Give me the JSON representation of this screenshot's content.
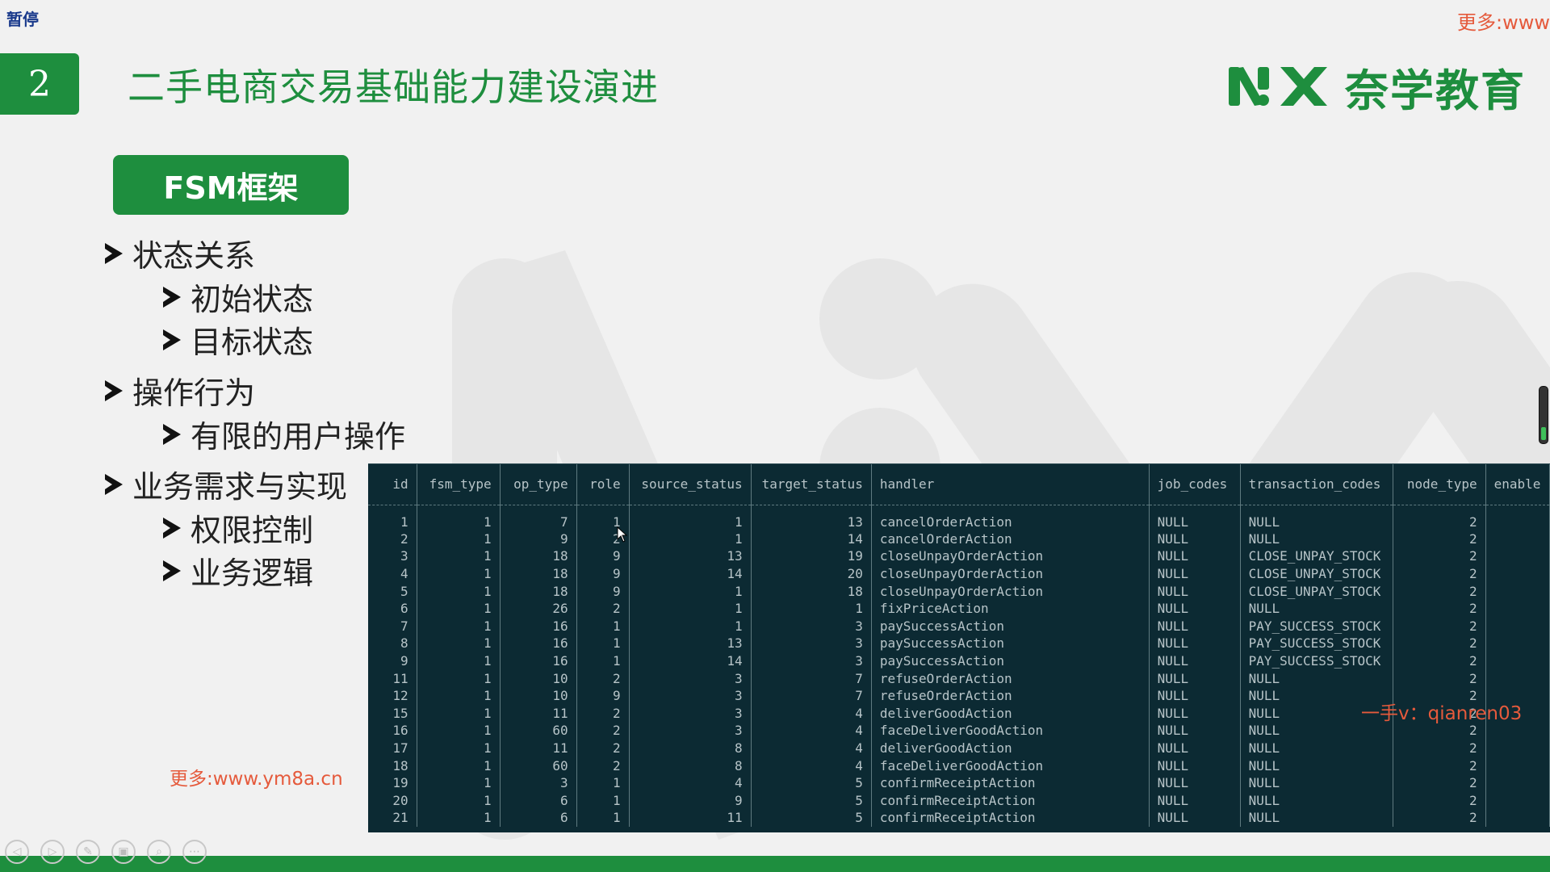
{
  "player": {
    "pause_label": "暂停",
    "controls": {
      "prev": "◁",
      "next": "▷",
      "pen": "✎",
      "slides": "▣",
      "zoom": "⌕",
      "more": "⋯"
    }
  },
  "watermarks": {
    "top_right": "更多:www",
    "left": "更多:www.ym8a.cn",
    "contact": "一手v：qianren03"
  },
  "slide": {
    "number": "2",
    "title": "二手电商交易基础能力建设演进",
    "logo_text": "奈学教育",
    "section_badge": "FSM框架",
    "bullets": [
      {
        "label": "状态关系",
        "sub": [
          "初始状态",
          "目标状态"
        ]
      },
      {
        "label": "操作行为",
        "sub": [
          "有限的用户操作"
        ]
      },
      {
        "label": "业务需求与实现",
        "sub": [
          "权限控制",
          "业务逻辑"
        ]
      }
    ]
  },
  "colors": {
    "brand_green": "#1e8e3e",
    "watermark_red": "#e55a3c",
    "terminal_bg": "#0c2a33",
    "terminal_text": "#b7c4c8"
  },
  "table": {
    "columns": [
      "id",
      "fsm_type",
      "op_type",
      "role",
      "source_status",
      "target_status",
      "handler",
      "job_codes",
      "transaction_codes",
      "node_type",
      "enable"
    ],
    "rows": [
      [
        "1",
        "1",
        "7",
        "1",
        "1",
        "13",
        "cancelOrderAction",
        "NULL",
        "NULL",
        "2"
      ],
      [
        "2",
        "1",
        "9",
        "2",
        "1",
        "14",
        "cancelOrderAction",
        "NULL",
        "NULL",
        "2"
      ],
      [
        "3",
        "1",
        "18",
        "9",
        "13",
        "19",
        "closeUnpayOrderAction",
        "NULL",
        "CLOSE_UNPAY_STOCK",
        "2"
      ],
      [
        "4",
        "1",
        "18",
        "9",
        "14",
        "20",
        "closeUnpayOrderAction",
        "NULL",
        "CLOSE_UNPAY_STOCK",
        "2"
      ],
      [
        "5",
        "1",
        "18",
        "9",
        "1",
        "18",
        "closeUnpayOrderAction",
        "NULL",
        "CLOSE_UNPAY_STOCK",
        "2"
      ],
      [
        "6",
        "1",
        "26",
        "2",
        "1",
        "1",
        "fixPriceAction",
        "NULL",
        "NULL",
        "2"
      ],
      [
        "7",
        "1",
        "16",
        "1",
        "1",
        "3",
        "paySuccessAction",
        "NULL",
        "PAY_SUCCESS_STOCK",
        "2"
      ],
      [
        "8",
        "1",
        "16",
        "1",
        "13",
        "3",
        "paySuccessAction",
        "NULL",
        "PAY_SUCCESS_STOCK",
        "2"
      ],
      [
        "9",
        "1",
        "16",
        "1",
        "14",
        "3",
        "paySuccessAction",
        "NULL",
        "PAY_SUCCESS_STOCK",
        "2"
      ],
      [
        "11",
        "1",
        "10",
        "2",
        "3",
        "7",
        "refuseOrderAction",
        "NULL",
        "NULL",
        "2"
      ],
      [
        "12",
        "1",
        "10",
        "9",
        "3",
        "7",
        "refuseOrderAction",
        "NULL",
        "NULL",
        "2"
      ],
      [
        "15",
        "1",
        "11",
        "2",
        "3",
        "4",
        "deliverGoodAction",
        "NULL",
        "NULL",
        "2"
      ],
      [
        "16",
        "1",
        "60",
        "2",
        "3",
        "4",
        "faceDeliverGoodAction",
        "NULL",
        "NULL",
        "2"
      ],
      [
        "17",
        "1",
        "11",
        "2",
        "8",
        "4",
        "deliverGoodAction",
        "NULL",
        "NULL",
        "2"
      ],
      [
        "18",
        "1",
        "60",
        "2",
        "8",
        "4",
        "faceDeliverGoodAction",
        "NULL",
        "NULL",
        "2"
      ],
      [
        "19",
        "1",
        "3",
        "1",
        "4",
        "5",
        "confirmReceiptAction",
        "NULL",
        "NULL",
        "2"
      ],
      [
        "20",
        "1",
        "6",
        "1",
        "9",
        "5",
        "confirmReceiptAction",
        "NULL",
        "NULL",
        "2"
      ],
      [
        "21",
        "1",
        "6",
        "1",
        "11",
        "5",
        "confirmReceiptAction",
        "NULL",
        "NULL",
        "2"
      ]
    ]
  }
}
